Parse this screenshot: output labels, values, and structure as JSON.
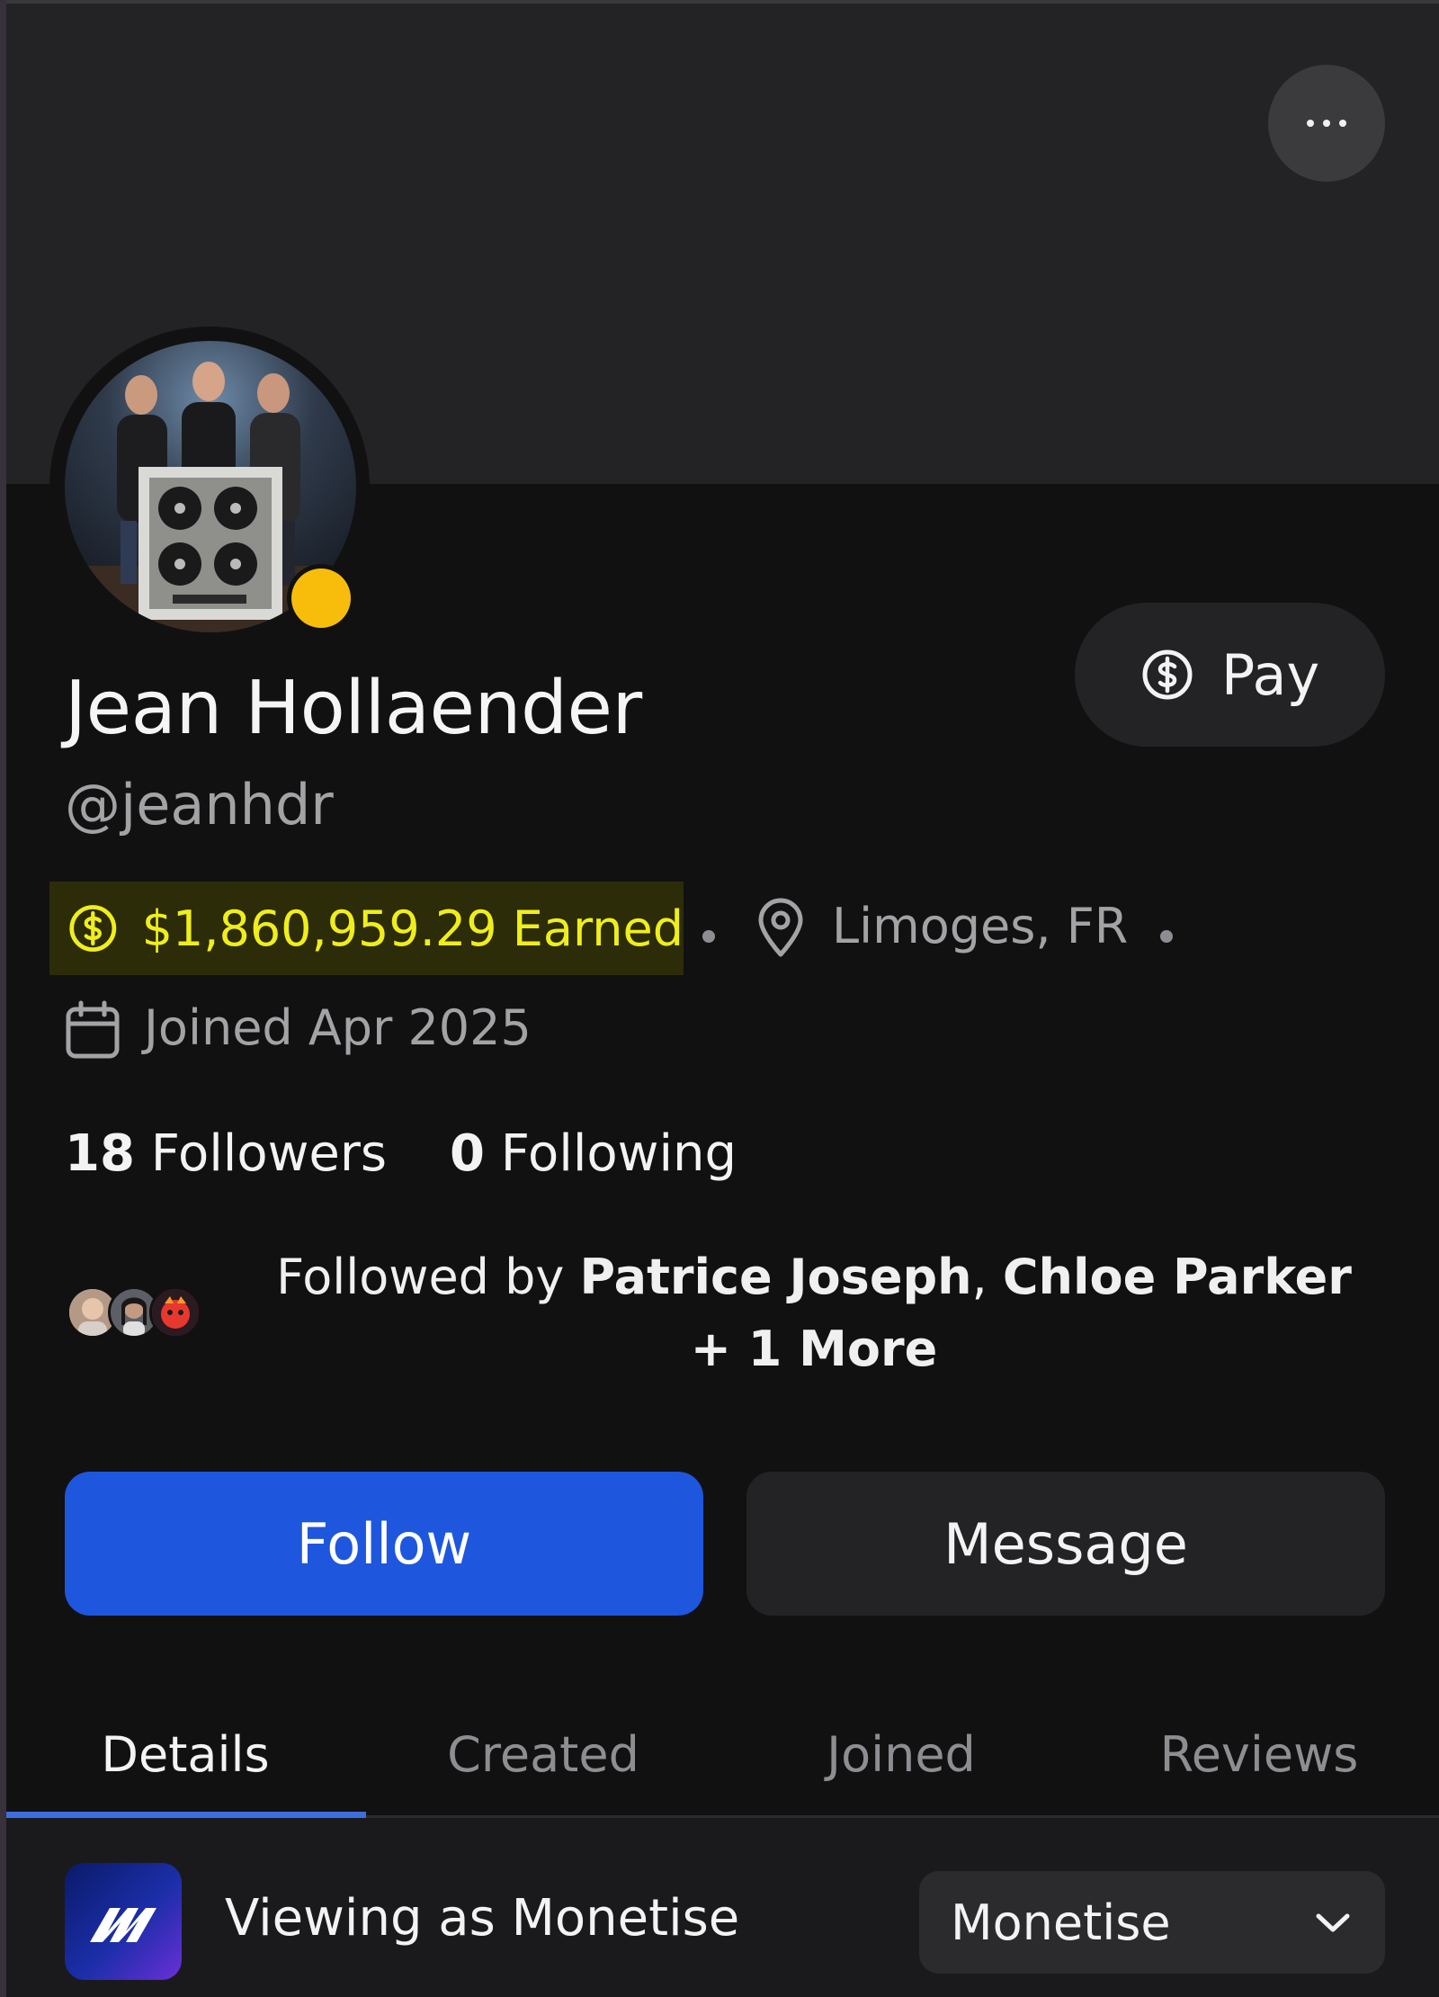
{
  "profile": {
    "name": "Jean Hollaender",
    "handle": "@jeanhdr",
    "earned": "$1,860,959.29 Earned",
    "location": "Limoges, FR",
    "joined": "Joined Apr 2025",
    "status_color": "#f8bd0a"
  },
  "header": {
    "more_icon": "more-horizontal-icon"
  },
  "actions": {
    "pay_label": "Pay",
    "follow_label": "Follow",
    "message_label": "Message"
  },
  "stats": {
    "followers_count": "18",
    "followers_label": "Followers",
    "following_count": "0",
    "following_label": "Following"
  },
  "followed_by": {
    "prefix": "Followed by",
    "name1": "Patrice Joseph",
    "separator": ",",
    "name2": "Chloe Parker + 1 More"
  },
  "tabs": [
    {
      "label": "Details",
      "active": true
    },
    {
      "label": "Created",
      "active": false
    },
    {
      "label": "Joined",
      "active": false
    },
    {
      "label": "Reviews",
      "active": false
    }
  ],
  "viewing": {
    "text": "Viewing as Monetise",
    "selected": "Monetise"
  },
  "colors": {
    "accent": "#1e57dd",
    "earned_text": "#f0ee1a",
    "earned_bg": "#2c2c09",
    "tab_underline": "#3c6ee0"
  }
}
